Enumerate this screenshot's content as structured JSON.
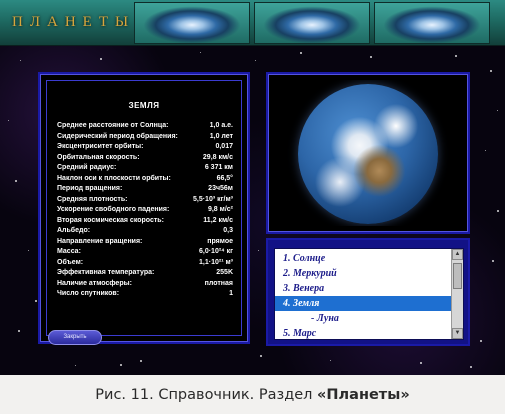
{
  "app": {
    "title": "ПЛАНЕТЫ"
  },
  "info": {
    "planet_name": "ЗЕМЛЯ",
    "rows": [
      {
        "label": "Среднее расстояние от Солнца:",
        "value": "1,0 а.е."
      },
      {
        "label": "Сидерический период обращения:",
        "value": "1,0 лет"
      },
      {
        "label": "Эксцентриситет орбиты:",
        "value": "0,017"
      },
      {
        "label": "Орбитальная скорость:",
        "value": "29,8 км/с"
      },
      {
        "label": "Средний радиус:",
        "value": "6 371 км"
      },
      {
        "label": "Наклон оси к плоскости орбиты:",
        "value": "66,5°"
      },
      {
        "label": "Период вращения:",
        "value": "23ч56м"
      },
      {
        "label": "Средняя плотность:",
        "value": "5,5·10³ кг/м³"
      },
      {
        "label": "Ускорение свободного падения:",
        "value": "9,8 м/с²"
      },
      {
        "label": "Вторая космическая скорость:",
        "value": "11,2 км/с"
      },
      {
        "label": "Альбедо:",
        "value": "0,3"
      },
      {
        "label": "Направление вращения:",
        "value": "прямое"
      },
      {
        "label": "Масса:",
        "value": "6,0·10²⁴ кг"
      },
      {
        "label": "Объем:",
        "value": "1,1·10²¹ м³"
      },
      {
        "label": "Эффективная температура:",
        "value": "255K"
      },
      {
        "label": "Наличие атмосферы:",
        "value": "плотная"
      },
      {
        "label": "Число спутников:",
        "value": "1"
      }
    ]
  },
  "buttons": {
    "close": "Закрыть"
  },
  "planet_list": {
    "items": [
      {
        "label": "1.  Солнце"
      },
      {
        "label": "2.  Меркурий"
      },
      {
        "label": "3.  Венера"
      },
      {
        "label": "4.  Земля",
        "selected": true
      },
      {
        "label": "- Луна",
        "sub": true
      },
      {
        "label": "5.  Марс"
      }
    ]
  },
  "caption": {
    "prefix": "Рис. 11. Справочник. Раздел ",
    "bold": "«Планеты»"
  },
  "colors": {
    "panel_border": "#1a1aa6",
    "selection": "#1e6fd1",
    "title_gold": "#d7a53c",
    "header_teal": "#1e6a62"
  }
}
